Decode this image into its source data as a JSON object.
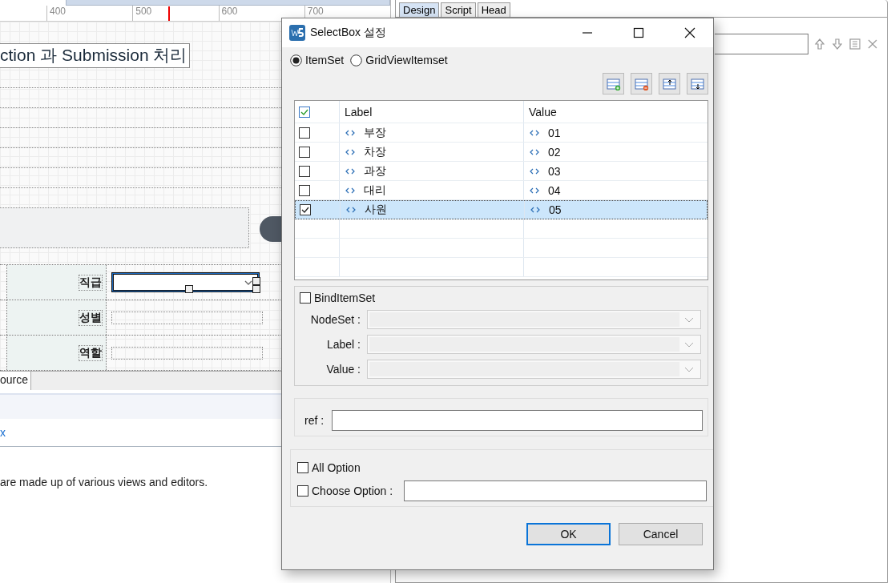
{
  "editor": {
    "ruler_ticks": [
      "400",
      "500",
      "600",
      "700"
    ],
    "heading": "ction 과 Submission 처리",
    "form_rows": [
      {
        "label": "직급",
        "kind": "select",
        "selected": true
      },
      {
        "label": "성별",
        "kind": "input",
        "selected": false
      },
      {
        "label": "역할",
        "kind": "input",
        "selected": false
      }
    ],
    "bottom_tab": "ource",
    "link": "x",
    "description": "are made up of various views and editors."
  },
  "right_panel": {
    "tabs": [
      {
        "label": "Design",
        "selected": true
      },
      {
        "label": "Script",
        "selected": false
      },
      {
        "label": "Head",
        "selected": false
      }
    ]
  },
  "dialog": {
    "title": "SelectBox 설정",
    "modes": [
      {
        "label": "ItemSet",
        "selected": true
      },
      {
        "label": "GridViewItemset",
        "selected": false
      }
    ],
    "table": {
      "all_checked": true,
      "columns": [
        "Label",
        "Value"
      ],
      "rows": [
        {
          "label": "부장",
          "value": "01",
          "checked": false,
          "selected": false
        },
        {
          "label": "차장",
          "value": "02",
          "checked": false,
          "selected": false
        },
        {
          "label": "과장",
          "value": "03",
          "checked": false,
          "selected": false
        },
        {
          "label": "대리",
          "value": "04",
          "checked": false,
          "selected": false
        },
        {
          "label": "사원",
          "value": "05",
          "checked": true,
          "selected": true
        }
      ]
    },
    "bind": {
      "label": "BindItemSet",
      "checked": false,
      "fields": [
        {
          "label": "NodeSet :",
          "disabled": true
        },
        {
          "label": "Label :",
          "disabled": true
        },
        {
          "label": "Value :",
          "disabled": true
        }
      ]
    },
    "ref_label": "ref :",
    "options": [
      {
        "label": "All Option",
        "checked": false,
        "kind": "check"
      },
      {
        "label": "Choose Option :",
        "checked": false,
        "kind": "field"
      }
    ],
    "buttons": [
      {
        "label": "OK",
        "default": true
      },
      {
        "label": "Cancel",
        "default": false
      }
    ]
  }
}
